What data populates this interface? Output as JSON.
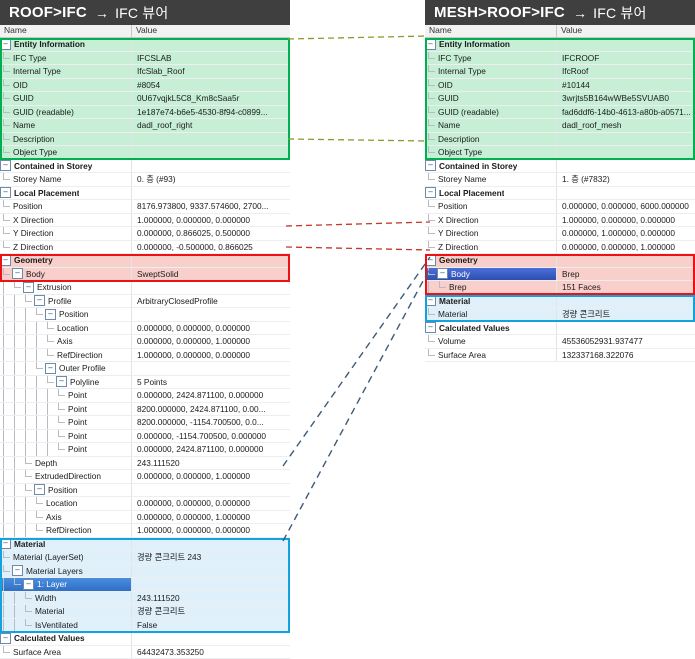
{
  "left_panel": {
    "title": {
      "path": "ROOF>IFC",
      "arrow": "→",
      "viewer": "IFC 뷰어"
    },
    "columns": {
      "name": "Name",
      "value": "Value"
    },
    "rows": [
      {
        "indent": 0,
        "label": "Entity Information",
        "value": "",
        "group": true,
        "tint": "green",
        "pm": "-"
      },
      {
        "indent": 1,
        "label": "IFC Type",
        "value": "IFCSLAB",
        "tint": "green"
      },
      {
        "indent": 1,
        "label": "Internal Type",
        "value": "IfcSlab_Roof",
        "tint": "green"
      },
      {
        "indent": 1,
        "label": "OID",
        "value": "#8054",
        "tint": "green"
      },
      {
        "indent": 1,
        "label": "GUID",
        "value": "0U67vqjkL5C8_Km8cSaa5r",
        "tint": "green"
      },
      {
        "indent": 1,
        "label": "GUID (readable)",
        "value": "1e187e74-b6e5-4530-8f94-c0899...",
        "tint": "green"
      },
      {
        "indent": 1,
        "label": "Name",
        "value": "dadl_roof_right",
        "tint": "green"
      },
      {
        "indent": 1,
        "label": "Description",
        "value": "",
        "tint": "green"
      },
      {
        "indent": 1,
        "label": "Object Type",
        "value": "",
        "tint": "green",
        "last": true
      },
      {
        "indent": 0,
        "label": "Contained in Storey",
        "value": "",
        "group": true,
        "pm": "-"
      },
      {
        "indent": 1,
        "label": "Storey Name",
        "value": "0. 층 (#93)",
        "last": true
      },
      {
        "indent": 0,
        "label": "Local Placement",
        "value": "",
        "group": true,
        "pm": "-"
      },
      {
        "indent": 1,
        "label": "Position",
        "value": "8176.973800, 9337.574600, 2700..."
      },
      {
        "indent": 1,
        "label": "X Direction",
        "value": "1.000000, 0.000000, 0.000000"
      },
      {
        "indent": 1,
        "label": "Y Direction",
        "value": "0.000000, 0.866025, 0.500000"
      },
      {
        "indent": 1,
        "label": "Z Direction",
        "value": "0.000000, -0.500000, 0.866025",
        "last": true
      },
      {
        "indent": 0,
        "label": "Geometry",
        "value": "",
        "group": true,
        "tint": "red",
        "pm": "-"
      },
      {
        "indent": 1,
        "label": "Body",
        "value": "SweptSolid",
        "tint": "red",
        "pm": "-",
        "last": true
      },
      {
        "indent": 2,
        "label": "Extrusion",
        "value": "",
        "pm": "-",
        "last": true
      },
      {
        "indent": 3,
        "label": "Profile",
        "value": "ArbitraryClosedProfile",
        "pm": "-"
      },
      {
        "indent": 4,
        "label": "Position",
        "value": "",
        "pm": "-"
      },
      {
        "indent": 5,
        "label": "Location",
        "value": "0.000000, 0.000000, 0.000000"
      },
      {
        "indent": 5,
        "label": "Axis",
        "value": "0.000000, 0.000000, 1.000000"
      },
      {
        "indent": 5,
        "label": "RefDirection",
        "value": "1.000000, 0.000000, 0.000000",
        "last": true
      },
      {
        "indent": 4,
        "label": "Outer Profile",
        "value": "",
        "pm": "-",
        "last": true
      },
      {
        "indent": 5,
        "label": "Polyline",
        "value": "5 Points",
        "pm": "-",
        "last": true
      },
      {
        "indent": 6,
        "label": "Point",
        "value": "0.000000, 2424.871100, 0.000000"
      },
      {
        "indent": 6,
        "label": "Point",
        "value": "8200.000000, 2424.871100, 0.00..."
      },
      {
        "indent": 6,
        "label": "Point",
        "value": "8200.000000, -1154.700500, 0.0..."
      },
      {
        "indent": 6,
        "label": "Point",
        "value": "0.000000, -1154.700500, 0.000000"
      },
      {
        "indent": 6,
        "label": "Point",
        "value": "0.000000, 2424.871100, 0.000000",
        "last": true
      },
      {
        "indent": 3,
        "label": "Depth",
        "value": "243.111520"
      },
      {
        "indent": 3,
        "label": "ExtrudedDirection",
        "value": "0.000000, 0.000000, 1.000000"
      },
      {
        "indent": 3,
        "label": "Position",
        "value": "",
        "pm": "-",
        "last": true
      },
      {
        "indent": 4,
        "label": "Location",
        "value": "0.000000, 0.000000, 0.000000"
      },
      {
        "indent": 4,
        "label": "Axis",
        "value": "0.000000, 0.000000, 1.000000"
      },
      {
        "indent": 4,
        "label": "RefDirection",
        "value": "1.000000, 0.000000, 0.000000",
        "last": true
      },
      {
        "indent": 0,
        "label": "Material",
        "value": "",
        "group": true,
        "tint": "blue",
        "pm": "-"
      },
      {
        "indent": 1,
        "label": "Material (LayerSet)",
        "value": "경량 콘크리트 243",
        "tint": "blue"
      },
      {
        "indent": 1,
        "label": "Material Layers",
        "value": "",
        "tint": "blue",
        "pm": "-",
        "last": true
      },
      {
        "indent": 2,
        "label": "1: Layer",
        "value": "",
        "tint": "blue",
        "pm": "-",
        "selected": true,
        "last": true
      },
      {
        "indent": 3,
        "label": "Width",
        "value": "243.111520",
        "tint": "blue"
      },
      {
        "indent": 3,
        "label": "Material",
        "value": "경량 콘크리트",
        "tint": "blue"
      },
      {
        "indent": 3,
        "label": "IsVentilated",
        "value": "False",
        "tint": "blue",
        "last": true
      },
      {
        "indent": 0,
        "label": "Calculated Values",
        "value": "",
        "group": true,
        "pm": "-"
      },
      {
        "indent": 1,
        "label": "Surface Area",
        "value": "64432473.353250",
        "last": true
      }
    ]
  },
  "right_panel": {
    "title": {
      "path": "MESH>ROOF>IFC",
      "arrow": "→",
      "viewer": "IFC 뷰어"
    },
    "columns": {
      "name": "Name",
      "value": "Value"
    },
    "rows": [
      {
        "indent": 0,
        "label": "Entity Information",
        "value": "",
        "group": true,
        "tint": "green",
        "pm": "-"
      },
      {
        "indent": 1,
        "label": "IFC Type",
        "value": "IFCROOF",
        "tint": "green"
      },
      {
        "indent": 1,
        "label": "Internal Type",
        "value": "IfcRoof",
        "tint": "green"
      },
      {
        "indent": 1,
        "label": "OID",
        "value": "#10144",
        "tint": "green"
      },
      {
        "indent": 1,
        "label": "GUID",
        "value": "3wrjts5B164wWBe5SVUAB0",
        "tint": "green"
      },
      {
        "indent": 1,
        "label": "GUID (readable)",
        "value": "fad6ddf6-14b0-4613-a80b-a0571...",
        "tint": "green"
      },
      {
        "indent": 1,
        "label": "Name",
        "value": "dadl_roof_mesh",
        "tint": "green"
      },
      {
        "indent": 1,
        "label": "Description",
        "value": "",
        "tint": "green"
      },
      {
        "indent": 1,
        "label": "Object Type",
        "value": "",
        "tint": "green",
        "last": true
      },
      {
        "indent": 0,
        "label": "Contained in Storey",
        "value": "",
        "group": true,
        "pm": "-"
      },
      {
        "indent": 1,
        "label": "Storey Name",
        "value": "1. 층 (#7832)",
        "last": true
      },
      {
        "indent": 0,
        "label": "Local Placement",
        "value": "",
        "group": true,
        "pm": "-"
      },
      {
        "indent": 1,
        "label": "Position",
        "value": "0.000000, 0.000000, 6000.000000"
      },
      {
        "indent": 1,
        "label": "X Direction",
        "value": "1.000000, 0.000000, 0.000000"
      },
      {
        "indent": 1,
        "label": "Y Direction",
        "value": "0.000000, 1.000000, 0.000000"
      },
      {
        "indent": 1,
        "label": "Z Direction",
        "value": "0.000000, 0.000000, 1.000000",
        "last": true
      },
      {
        "indent": 0,
        "label": "Geometry",
        "value": "",
        "group": true,
        "tint": "red",
        "pm": "-"
      },
      {
        "indent": 1,
        "label": "Body",
        "value": "Brep",
        "tint": "red",
        "pm": "-",
        "selected2": true,
        "last": true
      },
      {
        "indent": 2,
        "label": "Brep",
        "value": "151 Faces",
        "tint": "red",
        "last": true
      },
      {
        "indent": 0,
        "label": "Material",
        "value": "",
        "group": true,
        "tint": "blue",
        "pm": "-"
      },
      {
        "indent": 1,
        "label": "Material",
        "value": "경량 콘크리트",
        "tint": "blue",
        "last": true
      },
      {
        "indent": 0,
        "label": "Calculated Values",
        "value": "",
        "group": true,
        "pm": "-"
      },
      {
        "indent": 1,
        "label": "Volume",
        "value": "45536052931.937477"
      },
      {
        "indent": 1,
        "label": "Surface Area",
        "value": "132337168.322076",
        "last": true
      }
    ]
  },
  "highlights": {
    "green_color": "#00b050",
    "red_color": "#ee1111",
    "blue_color": "#13a2e0"
  },
  "connectors": [
    {
      "name": "entity-info-link-top",
      "color": "#8a9a2a",
      "style": "dashed"
    },
    {
      "name": "entity-info-link-bottom",
      "color": "#8a9a2a",
      "style": "dashed"
    },
    {
      "name": "geometry-link-top",
      "color": "#c0392b",
      "style": "dashed"
    },
    {
      "name": "geometry-link-bottom",
      "color": "#c0392b",
      "style": "dashed"
    },
    {
      "name": "material-link-top",
      "color": "#3c5a78",
      "style": "dashed"
    },
    {
      "name": "material-link-bottom",
      "color": "#3c5a78",
      "style": "dashed"
    }
  ]
}
